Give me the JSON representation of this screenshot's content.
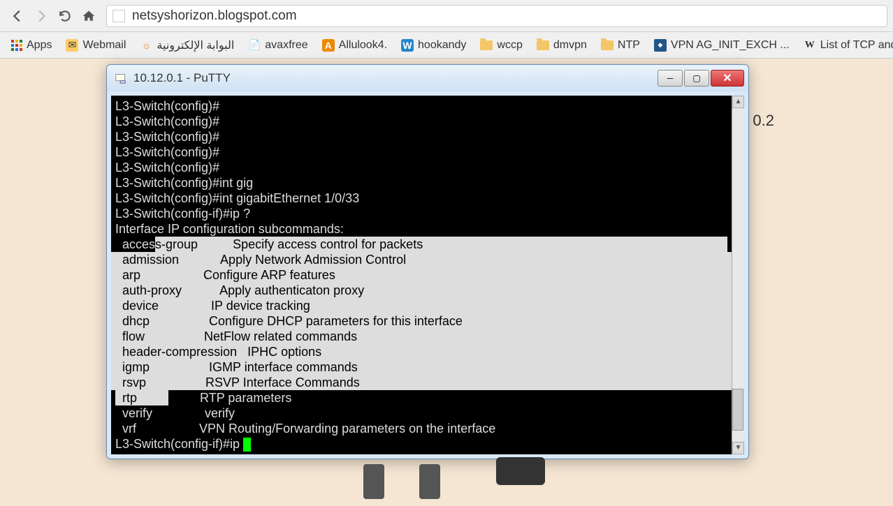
{
  "browser": {
    "url": "netsyshorizon.blogspot.com"
  },
  "bookmarks": {
    "apps": "Apps",
    "webmail": "Webmail",
    "portal": "البوابة الإلكترونية",
    "avaxfree": "avaxfree",
    "allulook": "Allulook4.",
    "hookandy": "hookandy",
    "wccp": "wccp",
    "dmvpn": "dmvpn",
    "ntp": "NTP",
    "vpnag": "VPN AG_INIT_EXCH ...",
    "tcp": "List of TCP and"
  },
  "bg_text": "0.2",
  "putty": {
    "title": "10.12.0.1 - PuTTY"
  },
  "terminal": {
    "l1": "L3-Switch(config)#",
    "l2": "L3-Switch(config)#",
    "l3": "L3-Switch(config)#",
    "l4": "L3-Switch(config)#",
    "l5": "L3-Switch(config)#",
    "l6": "L3-Switch(config)#int gig",
    "l7": "L3-Switch(config)#int gigabitEthernet 1/0/33",
    "l8": "L3-Switch(config-if)#ip ?",
    "l9": "Interface IP configuration subcommands:",
    "c1a": "  acces",
    "c1b": "s-group          Specify access control for packets",
    "c2": "  admission            Apply Network Admission Control",
    "c3": "  arp                  Configure ARP features",
    "c4": "  auth-proxy           Apply authenticaton proxy",
    "c5": "  device               IP device tracking",
    "c6": "  dhcp                 Configure DHCP parameters for this interface",
    "c7": "  flow                 NetFlow related commands",
    "c8": "  header-compression   IPHC options",
    "c9": "  igmp                 IGMP interface commands",
    "c10": "  rsvp                 RSVP Interface Commands",
    "c11a": "  rtp         ",
    "c11b": "         RTP parameters",
    "c12": "  verify               verify",
    "c13": "  vrf                  VPN Routing/Forwarding parameters on the interface",
    "blank": "",
    "prompt": "L3-Switch(config-if)#ip "
  }
}
